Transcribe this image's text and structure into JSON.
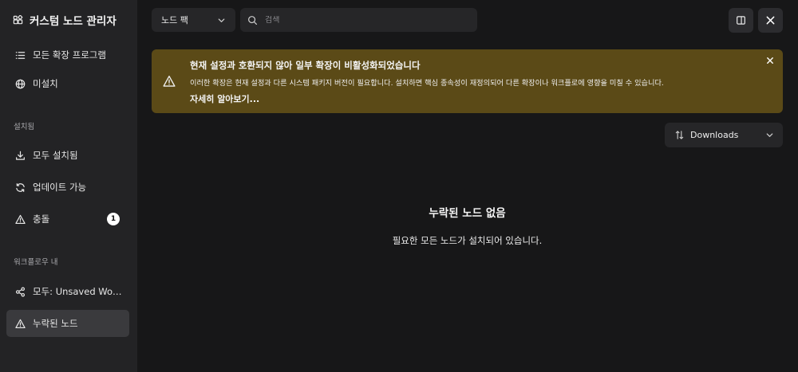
{
  "sidebar": {
    "title": "커스텀 노드 관리자",
    "top_items": [
      {
        "label": "모든 확장 프로그램",
        "icon": "list-icon"
      },
      {
        "label": "미설치",
        "icon": "globe-icon"
      }
    ],
    "installed_section": "설치됨",
    "installed_items": [
      {
        "label": "모두 설치됨",
        "icon": "download-icon"
      },
      {
        "label": "업데이트 가능",
        "icon": "refresh-icon"
      },
      {
        "label": "충돌",
        "icon": "warning-icon",
        "badge": "1"
      }
    ],
    "workflow_section": "워크플로우 내",
    "workflow_items": [
      {
        "label": "모두: Unsaved Work...",
        "icon": "share-icon"
      },
      {
        "label": "누락된 노드",
        "icon": "warning-icon",
        "active": true
      }
    ]
  },
  "toolbar": {
    "pack_select_value": "노드 팩",
    "search_placeholder": "검색"
  },
  "banner": {
    "title": "현재 설정과 호환되지 않아 일부 확장이 비활성화되었습니다",
    "description": "이러한 확장은 현재 설정과 다른 시스템 패키지 버전이 필요합니다. 설치하면 핵심 종속성이 재정의되어 다른 확장이나 워크플로에 영향을 미칠 수 있습니다.",
    "link": "자세히 알아보기...",
    "color": "#5b4a17"
  },
  "sort": {
    "value": "Downloads"
  },
  "empty_state": {
    "title": "누락된 노드 없음",
    "description": "필요한 모든 노드가 설치되어 있습니다."
  },
  "colors": {
    "background": "#171718",
    "sidebar": "#232325",
    "active_item": "#3a3a3d"
  }
}
